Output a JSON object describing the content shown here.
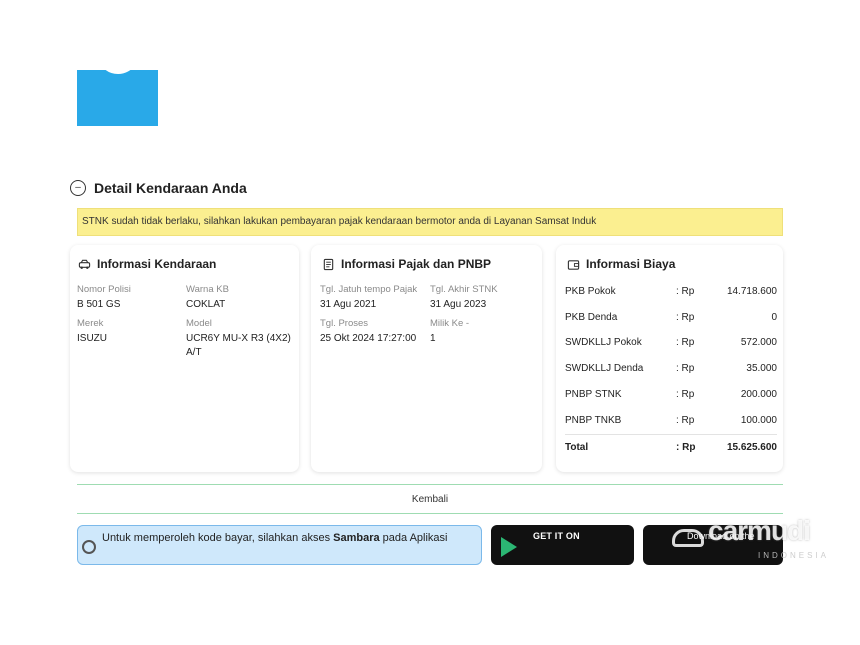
{
  "section": {
    "title": "Detail Kendaraan Anda",
    "alert": "STNK sudah tidak berlaku, silahkan lakukan pembayaran pajak kendaraan bermotor anda di Layanan Samsat Induk",
    "alert_color": "#fbef90"
  },
  "vehicle": {
    "title": "Informasi Kendaraan",
    "nopol_label": "Nomor Polisi",
    "nopol_value": "B 501 GS",
    "warna_label": "Warna KB",
    "warna_value": "COKLAT",
    "merek_label": "Merek",
    "merek_value": "ISUZU",
    "model_label": "Model",
    "model_value_line1": "UCR6Y MU-X R3 (4X2)",
    "model_value_line2": "A/T"
  },
  "tax": {
    "title": "Informasi Pajak dan PNBP",
    "jatuh_tempo_label": "Tgl. Jatuh tempo Pajak",
    "jatuh_tempo_value": "31 Agu 2021",
    "akhir_stnk_label": "Tgl. Akhir STNK",
    "akhir_stnk_value": "31 Agu 2023",
    "proses_label": "Tgl. Proses",
    "proses_value": "25 Okt 2024 17:27:00",
    "milik_label": "Milik Ke -",
    "milik_value": "1"
  },
  "costs": {
    "title": "Informasi Biaya",
    "currency": ": Rp",
    "rows": [
      {
        "label": "PKB Pokok",
        "value": "14.718.600"
      },
      {
        "label": "PKB Denda",
        "value": "0"
      },
      {
        "label": "SWDKLLJ Pokok",
        "value": "572.000"
      },
      {
        "label": "SWDKLLJ Denda",
        "value": "35.000"
      },
      {
        "label": "PNBP STNK",
        "value": "200.000"
      },
      {
        "label": "PNBP TNKB",
        "value": "100.000"
      }
    ],
    "total_label": "Total",
    "total_value": "15.625.600"
  },
  "actions": {
    "back_label": "Kembali"
  },
  "info": {
    "text_before": "Untuk memperoleh kode bayar, silahkan akses ",
    "text_bold": "Sambara",
    "text_after": " pada Aplikasi"
  },
  "stores": {
    "google_play_top": "GET IT ON",
    "second_store_text": "Download on the"
  },
  "watermark": {
    "word": "carmudi",
    "sub": "INDONESIA"
  },
  "colors": {
    "logo_blue": "#29a9e8",
    "divider_green": "#9fdcb2",
    "info_blue": "#cfe8fb"
  }
}
